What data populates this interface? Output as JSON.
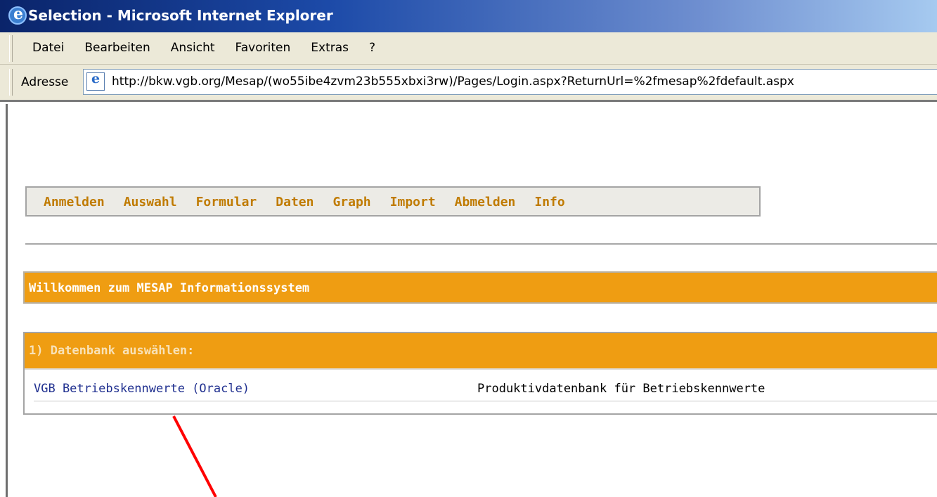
{
  "window": {
    "title": "Selection - Microsoft Internet Explorer",
    "icon": "ie-icon"
  },
  "menu": {
    "items": [
      "Datei",
      "Bearbeiten",
      "Ansicht",
      "Favoriten",
      "Extras",
      "?"
    ]
  },
  "address": {
    "label": "Adresse",
    "url": "http://bkw.vgb.org/Mesap/(wo55ibe4zvm23b555xbxi3rw)/Pages/Login.aspx?ReturnUrl=%2fmesap%2fdefault.aspx"
  },
  "nav": {
    "items": [
      "Anmelden",
      "Auswahl",
      "Formular",
      "Daten",
      "Graph",
      "Import",
      "Abmelden",
      "Info"
    ]
  },
  "welcome": {
    "text": "Willkommen zum MESAP Informationssystem"
  },
  "database": {
    "header": "1) Datenbank auswählen:",
    "rows": [
      {
        "name": "VGB Betriebskennwerte (Oracle)",
        "description": "Produktivdatenbank für Betriebskennwerte"
      }
    ]
  },
  "colors": {
    "accent_orange": "#ef9d12",
    "nav_text": "#c07b00",
    "link": "#1f2f8f",
    "annotation_arrow": "#ff0000"
  }
}
